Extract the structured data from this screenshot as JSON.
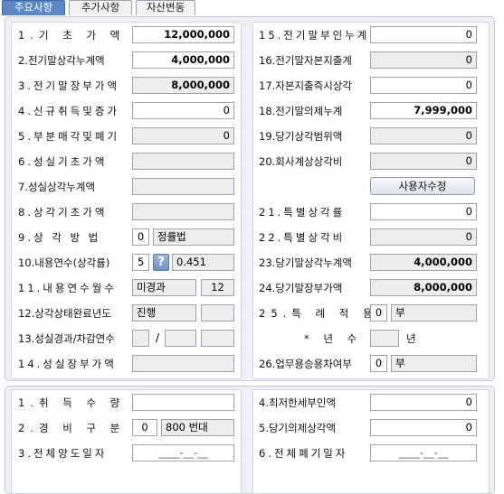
{
  "tabs": [
    "주요사항",
    "추가사항",
    "자산변동"
  ],
  "left": {
    "items": [
      {
        "label": "1.기 초 가 액",
        "value": "12,000,000"
      },
      {
        "label": "2.전기말상각누계액",
        "value": "4,000,000"
      },
      {
        "label": "3.전기말장부가액",
        "value": "8,000,000"
      },
      {
        "label": "4.신규취득및증가",
        "value": "0"
      },
      {
        "label": "5.부분매각및폐기",
        "value": "0"
      },
      {
        "label": "6.성실기초가액",
        "value": ""
      },
      {
        "label": "7.성실상각누계액",
        "value": ""
      },
      {
        "label": "8.상각기초가액",
        "value": ""
      },
      {
        "label": "9.상 각 방 법",
        "code": "0",
        "name": "정률법"
      },
      {
        "label": "10.내용연수(상각률)",
        "years": "5",
        "rate": "0.451"
      },
      {
        "label": "11.내용연수월수",
        "status": "미경과",
        "months": "12"
      },
      {
        "label": "12.상각상태완료년도",
        "status": "진행",
        "year": ""
      },
      {
        "label": "13.성실경과/차감연수",
        "a": "",
        "sep": "/",
        "b": "",
        "c": ""
      },
      {
        "label": "14.성실장부가액",
        "value": ""
      }
    ]
  },
  "right": {
    "items": [
      {
        "label": "15.전기말부인누계",
        "value": "0"
      },
      {
        "label": "16.전기말자본지출계",
        "value": "0"
      },
      {
        "label": "17.자본지출즉시상각",
        "value": "0"
      },
      {
        "label": "18.전기말의제누계",
        "value": "7,999,000"
      },
      {
        "label": "19.당기상각범위액",
        "value": "0"
      },
      {
        "label": "20.회사계상상각비",
        "value": "0"
      },
      {
        "label": "21.특별상각률",
        "value": "0"
      },
      {
        "label": "22.특별상각비",
        "value": "0"
      },
      {
        "label": "23.당기말상각누계액",
        "value": "4,000,000"
      },
      {
        "label": "24.당기말장부가액",
        "value": "8,000,000"
      },
      {
        "label": "25.특 례 적 용",
        "code": "0",
        "name": "부"
      },
      {
        "label": "* 년 수",
        "value": "",
        "unit": "년"
      },
      {
        "label": "26.업무용승용차여부",
        "code": "0",
        "name": "부"
      }
    ],
    "user_edit_button": "사용자수정"
  },
  "bottom": {
    "left": [
      {
        "label": "1.취 득 수 량",
        "value": ""
      },
      {
        "label": "2.경 비 구 분",
        "code": "0",
        "name": "800 번대"
      },
      {
        "label": "3.전체양도일자",
        "value": "____-__-__"
      }
    ],
    "right": [
      {
        "label": "4.최저한세부인액",
        "value": "0"
      },
      {
        "label": "5.당기의제상각액",
        "value": "0"
      },
      {
        "label": "6.전체폐기일자",
        "value": "____-__-__"
      }
    ]
  }
}
